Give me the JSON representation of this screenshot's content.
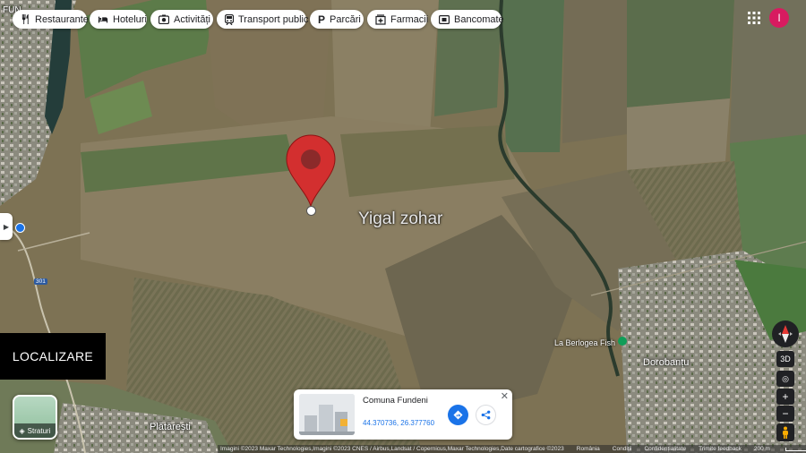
{
  "categories": [
    {
      "label": "Restaurante",
      "icon": "fork-knife-icon"
    },
    {
      "label": "Hoteluri",
      "icon": "bed-icon"
    },
    {
      "label": "Activități",
      "icon": "camera-icon"
    },
    {
      "label": "Transport public",
      "icon": "train-icon"
    },
    {
      "label": "Parcări",
      "icon": "parking-icon"
    },
    {
      "label": "Farmacii",
      "icon": "pharmacy-icon"
    },
    {
      "label": "Bancomate",
      "icon": "atm-icon"
    }
  ],
  "account": {
    "initial": "I",
    "color": "#d81b60"
  },
  "pin": {
    "label": "Yigal zohar",
    "color": "#d32f2f"
  },
  "map_labels": {
    "town_topleft": "FUN",
    "road_number": "301",
    "fish_place": "La Berlogea Fish",
    "village_right": "Dorobanțu",
    "village_bottom": "Plătărești"
  },
  "overlay": {
    "localizare": "LOCALIZARE"
  },
  "layers": {
    "label": "Straturi"
  },
  "place_card": {
    "name": "Comuna Fundeni",
    "coords": "44.370736, 26.377760",
    "accent": "#1a73e8"
  },
  "controls": {
    "mode_3d": "3D",
    "zoom_in": "+",
    "zoom_out": "−"
  },
  "footer": {
    "attribution": "Imagini ©2023 Maxar Technologies,Imagini ©2023 CNES / Airbus,Landsat / Copernicus,Maxar Technologies,Date cartografice ©2023",
    "country": "România",
    "terms": "Condiții",
    "privacy": "Confidențialitate",
    "feedback": "Trimite feedback",
    "scale": "200 m"
  }
}
